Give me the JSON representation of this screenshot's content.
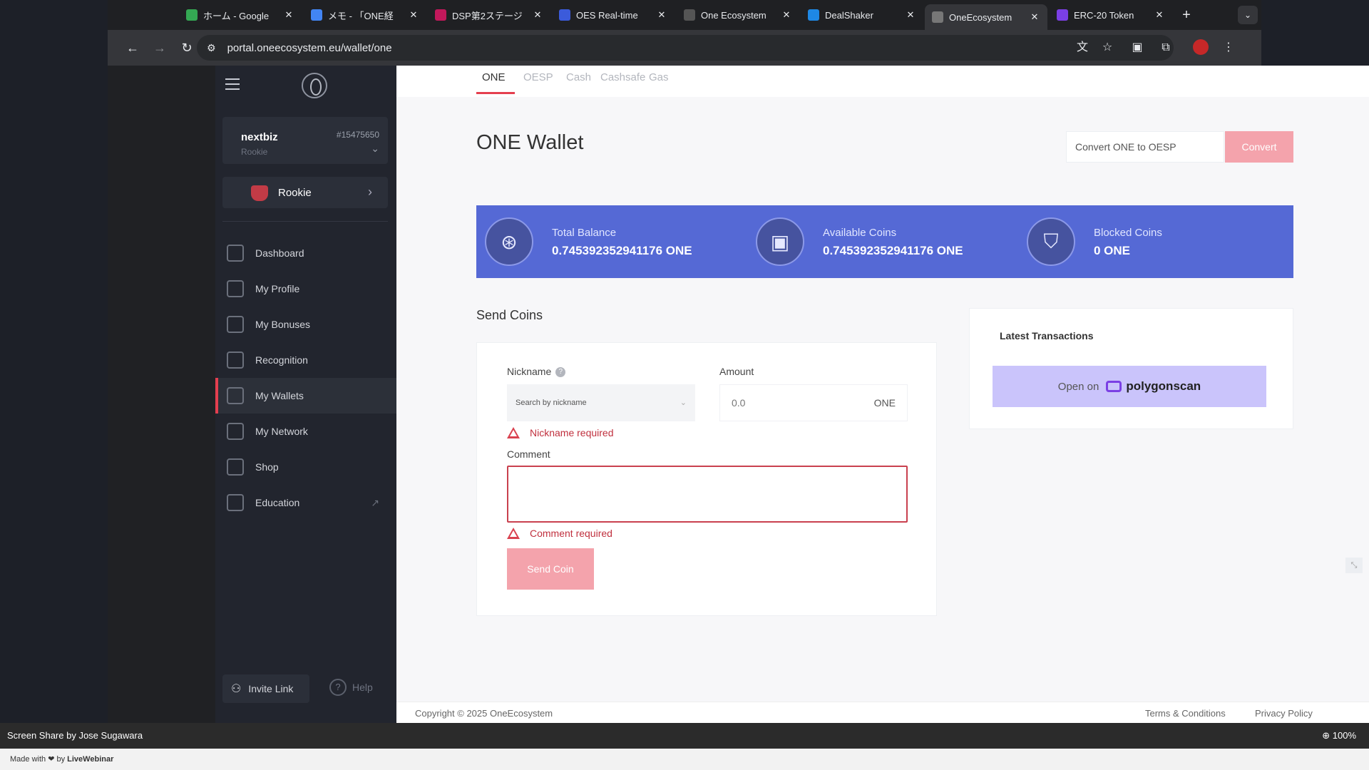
{
  "browser": {
    "tabs": [
      {
        "title": "ホーム - Google",
        "fav_color": "#34a853",
        "active": false
      },
      {
        "title": "メモ - 「ONE経",
        "fav_color": "#4285f4",
        "active": false
      },
      {
        "title": "DSP第2ステージ",
        "fav_color": "#c2185b",
        "active": false
      },
      {
        "title": "OES Real-time",
        "fav_color": "#3b5bdb",
        "active": false
      },
      {
        "title": "One Ecosystem",
        "fav_color": "#555555",
        "active": false
      },
      {
        "title": "DealShaker",
        "fav_color": "#1e88e5",
        "active": false
      },
      {
        "title": "OneEcosystem",
        "fav_color": "#777777",
        "active": true
      },
      {
        "title": "ERC-20 Token",
        "fav_color": "#7b3fe4",
        "active": false
      }
    ],
    "url": "portal.oneecosystem.eu/wallet/one"
  },
  "sidebar": {
    "username": "nextbiz",
    "user_rank": "Rookie",
    "user_id": "#15475650",
    "rank_button": "Rookie",
    "nav": [
      {
        "label": "Dashboard",
        "name": "dashboard",
        "active": false
      },
      {
        "label": "My Profile",
        "name": "my-profile",
        "active": false
      },
      {
        "label": "My Bonuses",
        "name": "my-bonuses",
        "active": false
      },
      {
        "label": "Recognition",
        "name": "recognition",
        "active": false
      },
      {
        "label": "My Wallets",
        "name": "my-wallets",
        "active": true
      },
      {
        "label": "My Network",
        "name": "my-network",
        "active": false
      },
      {
        "label": "Shop",
        "name": "shop",
        "active": false
      },
      {
        "label": "Education",
        "name": "education",
        "active": false
      }
    ],
    "invite_label": "Invite Link",
    "help_label": "Help"
  },
  "wallet_tabs": [
    "ONE",
    "OESP",
    "Cash",
    "Cashsafe",
    "Gas"
  ],
  "main": {
    "title": "ONE Wallet",
    "convert_placeholder": "Convert ONE to OESP",
    "convert_button": "Convert",
    "balance": {
      "total_label": "Total Balance",
      "total_value": "0.745392352941176 ONE",
      "available_label": "Available Coins",
      "available_value": "0.745392352941176 ONE",
      "blocked_label": "Blocked Coins",
      "blocked_value": "0 ONE"
    },
    "send": {
      "title": "Send Coins",
      "nickname_label": "Nickname",
      "nickname_placeholder": "Search by nickname",
      "amount_label": "Amount",
      "amount_value": "0.0",
      "amount_unit": "ONE",
      "nickname_error": "Nickname required",
      "comment_label": "Comment",
      "comment_error": "Comment required",
      "send_button": "Send Coin"
    },
    "latest": {
      "title": "Latest Transactions",
      "open_on": "Open on",
      "provider": "polygonscan"
    },
    "footer": {
      "copyright": "Copyright © 2025 OneEcosystem",
      "terms": "Terms & Conditions",
      "privacy": "Privacy Policy"
    }
  },
  "sharebar": {
    "text": "Screen Share by Jose Sugawara",
    "zoom": "100%",
    "made_prefix": "Made with ❤ by",
    "made_brand": "LiveWebinar"
  }
}
